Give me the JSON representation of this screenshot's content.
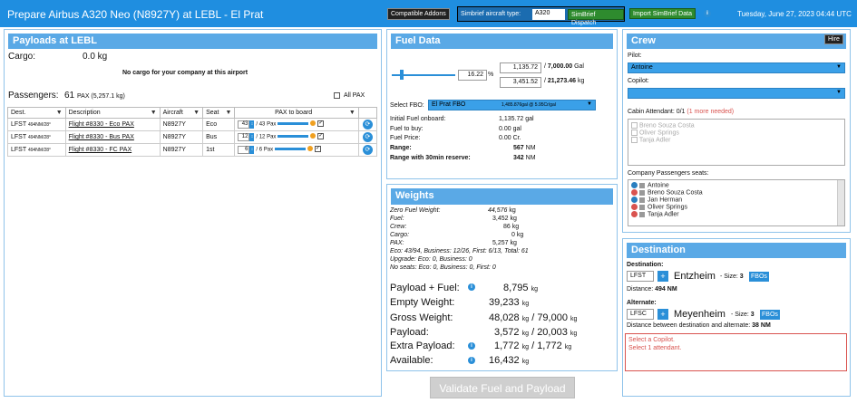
{
  "header": {
    "title": "Prepare Airbus A320 Neo (N8927Y) at LEBL - El Prat",
    "compatible_addons": "Compatible Addons",
    "simbrief_type_label": "Simbrief aircraft type:",
    "simbrief_type_value": "A320",
    "simbrief_dispatch": "SimBrief Dispatch",
    "import_simbrief": "Import SimBrief Data",
    "datetime": "Tuesday, June 27, 2023 04:44 UTC"
  },
  "payloads": {
    "title": "Payloads at LEBL",
    "cargo_label": "Cargo:",
    "cargo_value": "0.0 kg",
    "no_cargo": "No cargo for your company at this airport",
    "passengers_label": "Passengers:",
    "passengers_count": "61",
    "passengers_detail": "PAX (5,257.1 kg)",
    "all_pax_label": "All PAX",
    "columns": [
      "Dest.",
      "Description",
      "Aircraft",
      "Seat",
      "PAX to board"
    ],
    "rows": [
      {
        "dest": "LFST",
        "dist": "494NM/28°",
        "desc": "Flight #8330 - Eco PAX",
        "aircraft": "N8927Y",
        "seat": "Eco",
        "qty": "43",
        "max": "/ 43 Pax"
      },
      {
        "dest": "LFST",
        "dist": "494NM/28°",
        "desc": "Flight #8330 - Bus PAX",
        "aircraft": "N8927Y",
        "seat": "Bus",
        "qty": "12",
        "max": "/ 12 Pax"
      },
      {
        "dest": "LFST",
        "dist": "494NM/28°",
        "desc": "Flight #8330 - FC PAX",
        "aircraft": "N8927Y",
        "seat": "1st",
        "qty": "6",
        "max": "/ 6 Pax"
      }
    ]
  },
  "fuel": {
    "title": "Fuel Data",
    "percent": "16.22",
    "percent_unit": "%",
    "gal_value": "1,135.72",
    "gal_total": "7,000.00",
    "gal_unit": "Gal",
    "kg_value": "3,451.52",
    "kg_total": "21,273.46",
    "kg_unit": "kg",
    "select_fbo_label": "Select FBO:",
    "fbo_name": "El Prat FBO",
    "fbo_price": "1,485.876gal @ 5.95Cr/gal",
    "rows": [
      {
        "label": "Initial Fuel onboard:",
        "value": "1,135.72 gal"
      },
      {
        "label": "Fuel to buy:",
        "value": "0.00 gal"
      },
      {
        "label": "Fuel Price:",
        "value": "0.00 Cr."
      }
    ],
    "range_label": "Range:",
    "range_value": "567",
    "range_reserve_label": "Range with 30min reserve:",
    "range_reserve_value": "342",
    "nm": "NM"
  },
  "weights": {
    "title": "Weights",
    "rows": [
      {
        "label": "Zero Fuel Weight:",
        "value": "44,576",
        "unit": "kg"
      },
      {
        "label": "Fuel:",
        "value": "3,452",
        "unit": "kg"
      },
      {
        "label": "Crew:",
        "value": "86",
        "unit": "kg"
      },
      {
        "label": "Cargo:",
        "value": "0",
        "unit": "kg"
      },
      {
        "label": "PAX:",
        "value": "5,257",
        "unit": "kg"
      }
    ],
    "pax_breakdown": "Eco: 43/94, Business: 12/26, First: 6/13, Total: 61",
    "upgrade": "Upgrade: Eco: 0, Business: 0",
    "no_seats": "No seats: Eco: 0, Business: 0, First: 0",
    "payload_fuel_label": "Payload + Fuel:",
    "payload_fuel_value": "8,795",
    "empty_label": "Empty Weight:",
    "empty_value": "39,233",
    "gross_label": "Gross Weight:",
    "gross_value": "48,028",
    "gross_max": "79,000",
    "payload_label": "Payload:",
    "payload_value": "3,572",
    "payload_max": "20,003",
    "extra_label": "Extra Payload:",
    "extra_value": "1,772",
    "extra_max": "1,772",
    "available_label": "Available:",
    "available_value": "16,432",
    "kg": "kg",
    "slash": "/"
  },
  "crew": {
    "title": "Crew",
    "hire": "Hire",
    "pilot_label": "Pilot:",
    "pilot_value": "Antoine",
    "copilot_label": "Copilot:",
    "attendant_label": "Cabin Attendant: 0/1",
    "attendant_needed": "(1 more needed)",
    "attendants": [
      "Breno Souza Costa",
      "Oliver Springs",
      "Tanja Adler"
    ],
    "company_pax_label": "Company Passengers seats:",
    "company_pax": [
      "Antoine",
      "Breno Souza Costa",
      "Jan Herman",
      "Oliver Springs",
      "Tanja Adler"
    ]
  },
  "destination": {
    "title": "Destination",
    "dest_label": "Destination:",
    "dest_icao": "LFST",
    "dest_name": "Entzheim",
    "dest_size": "- Size: 3",
    "fbos": "FBOs",
    "distance_label": "Distance:",
    "distance_value": "494 NM",
    "alt_label": "Alternate:",
    "alt_icao": "LFSC",
    "alt_name": "Meyenheim",
    "alt_size": "- Size: 3",
    "alt_distance_label": "Distance between destination and alternate:",
    "alt_distance_value": "38 NM",
    "errors": [
      "Select a Copilot.",
      "Select 1 attendant."
    ]
  },
  "validate": "Validate Fuel and Payload",
  "colors": {
    "header_bg": "#1f8ee0",
    "panel_head": "#5aa9e6",
    "error": "#d9534f"
  }
}
